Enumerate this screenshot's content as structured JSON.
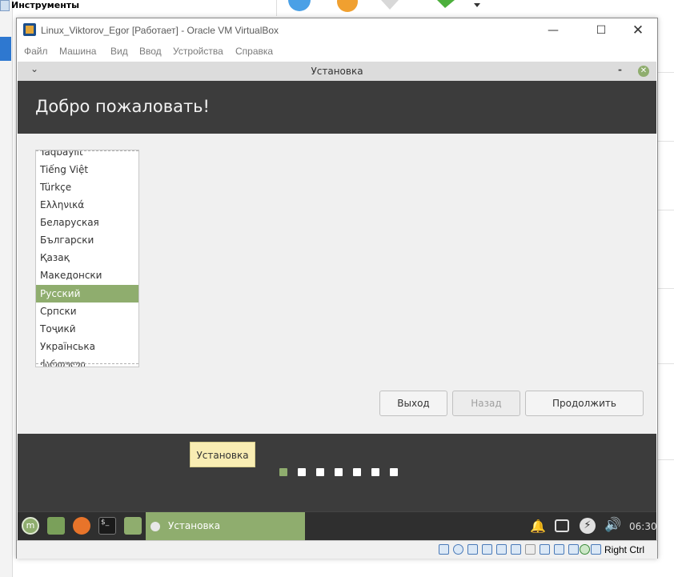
{
  "background": {
    "tools_label": "Инструменты"
  },
  "window": {
    "title": "Linux_Viktorov_Egor [Работает] - Oracle VM VirtualBox",
    "menu": [
      "Файл",
      "Машина",
      "Вид",
      "Ввод",
      "Устройства",
      "Справка"
    ]
  },
  "installer": {
    "title": "Установка",
    "heading": "Добро пожаловать!",
    "languages": [
      "Taqbaylit",
      "Tiếng Việt",
      "Türkçe",
      "Ελληνικά",
      "Беларуская",
      "Български",
      "Қазақ",
      "Македонски",
      "Русский",
      "Српски",
      "Тоҷикӣ",
      "Українська",
      "ქართული"
    ],
    "selected_language": "Русский",
    "buttons": {
      "quit": "Выход",
      "back": "Назад",
      "continue": "Продолжить"
    },
    "progress": {
      "current_step": 1,
      "total_steps": 7
    }
  },
  "tooltip": "Установка",
  "taskbar": {
    "active_task": "Установка",
    "clock": "06:30"
  },
  "status": {
    "host_key": "Right Ctrl"
  },
  "colors": {
    "accent": "#8fad6e",
    "header": "#3c3c3c"
  }
}
